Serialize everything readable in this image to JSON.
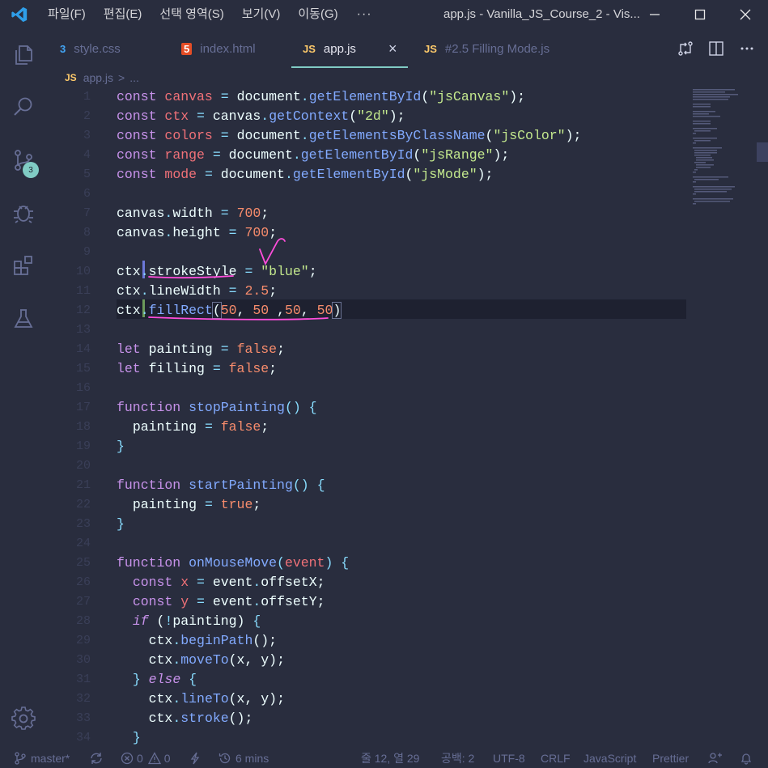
{
  "titlebar": {
    "menu": [
      "파일(F)",
      "편집(E)",
      "선택 영역(S)",
      "보기(V)",
      "이동(G)"
    ],
    "more": "···",
    "window_title": "app.js - Vanilla_JS_Course_2 - Vis..."
  },
  "activity": {
    "scm_badge": "3"
  },
  "tabs": [
    {
      "label": "style.css",
      "icon": "css3-icon",
      "icon_text": "3"
    },
    {
      "label": "index.html",
      "icon": "html5-icon",
      "icon_text": "5"
    },
    {
      "label": "app.js",
      "icon": "js-icon",
      "icon_text": "JS",
      "close": "×"
    },
    {
      "label": "#2.5 Filling Mode.js",
      "icon": "js-icon",
      "icon_text": "JS"
    }
  ],
  "breadcrumb": {
    "icon_text": "JS",
    "file": "app.js",
    "sep": ">",
    "rest": "..."
  },
  "line_numbers": [
    "1",
    "2",
    "3",
    "4",
    "5",
    "6",
    "7",
    "8",
    "9",
    "10",
    "11",
    "12",
    "13",
    "14",
    "15",
    "16",
    "17",
    "18",
    "19",
    "20",
    "21",
    "22",
    "23",
    "24",
    "25",
    "26",
    "27",
    "28",
    "29",
    "30",
    "31",
    "32",
    "33",
    "34"
  ],
  "status": {
    "branch": "master*",
    "errors": "0",
    "warnings": "0",
    "time": "6 mins",
    "position": "줄 12, 열 29",
    "indent": "공백: 2",
    "encoding": "UTF-8",
    "eol": "CRLF",
    "language": "JavaScript",
    "formatter": "Prettier"
  },
  "colors": {
    "background": "#292d3e",
    "accent": "#80cbc4",
    "annotation": "#ff4ddb"
  }
}
